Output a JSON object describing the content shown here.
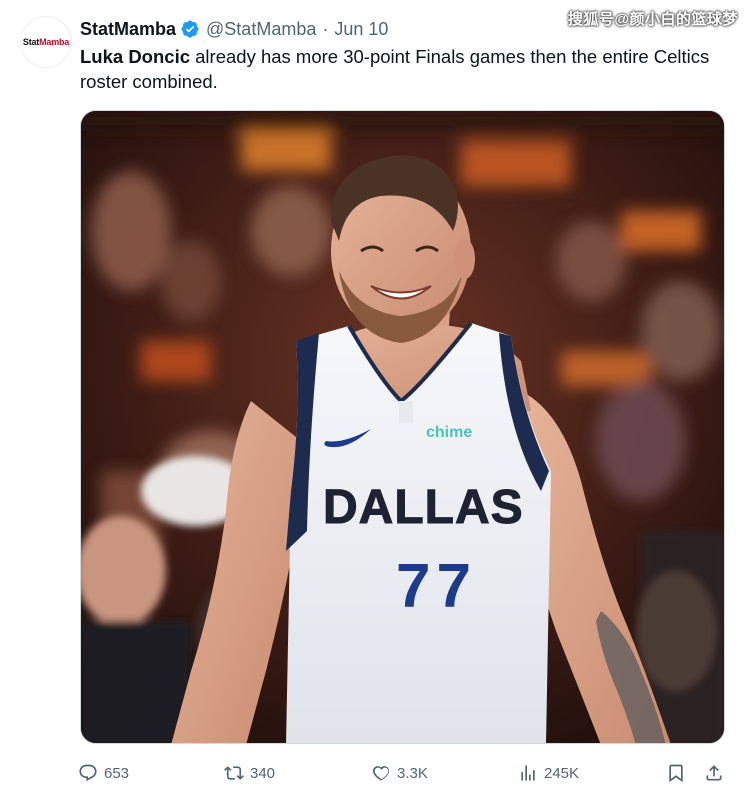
{
  "author": {
    "name": "StatMamba",
    "handle": "@StatMamba",
    "separator": "·",
    "date": "Jun 10",
    "verified_color": "#1d9bf0",
    "avatar_logo": "StatMamba"
  },
  "watermark": "搜狐号@颜小白的篮球梦",
  "tweet": {
    "mention": "Luka Doncic",
    "text": " already has more 30-point Finals games then the entire Celtics roster combined."
  },
  "media": {
    "jersey_team": "DALLAS",
    "jersey_number": "77",
    "sponsor": "chime"
  },
  "actions": {
    "reply_count": "653",
    "retweet_count": "340",
    "like_count": "3.3K",
    "views_count": "245K"
  },
  "icons": [
    "verified-badge-icon",
    "reply-icon",
    "retweet-icon",
    "like-icon",
    "views-icon",
    "bookmark-icon",
    "share-icon"
  ]
}
